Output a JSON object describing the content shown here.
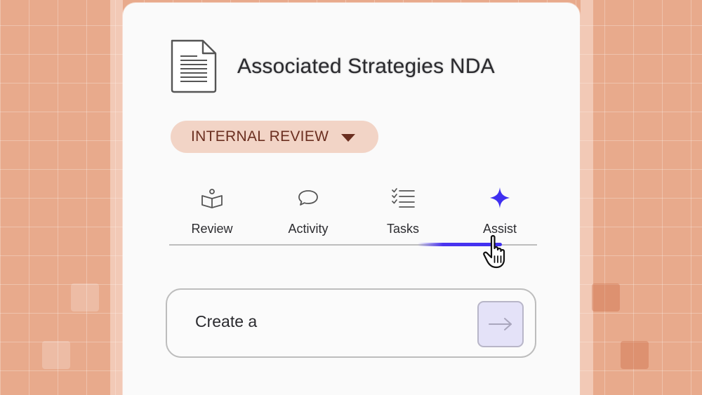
{
  "document": {
    "title": "Associated Strategies NDA",
    "icon": "document-icon"
  },
  "status": {
    "label": "INTERNAL REVIEW",
    "icon": "caret-down-icon",
    "color": "#6b2f20",
    "background": "#f2d4c6"
  },
  "tabs": [
    {
      "label": "Review",
      "icon": "open-book-icon"
    },
    {
      "label": "Activity",
      "icon": "speech-bubble-icon"
    },
    {
      "label": "Tasks",
      "icon": "checklist-icon"
    },
    {
      "label": "Assist",
      "icon": "sparkle-icon",
      "active": true
    }
  ],
  "accent_color": "#4a34ef",
  "prompt": {
    "value": "Create a",
    "send_icon": "arrow-right-icon"
  }
}
